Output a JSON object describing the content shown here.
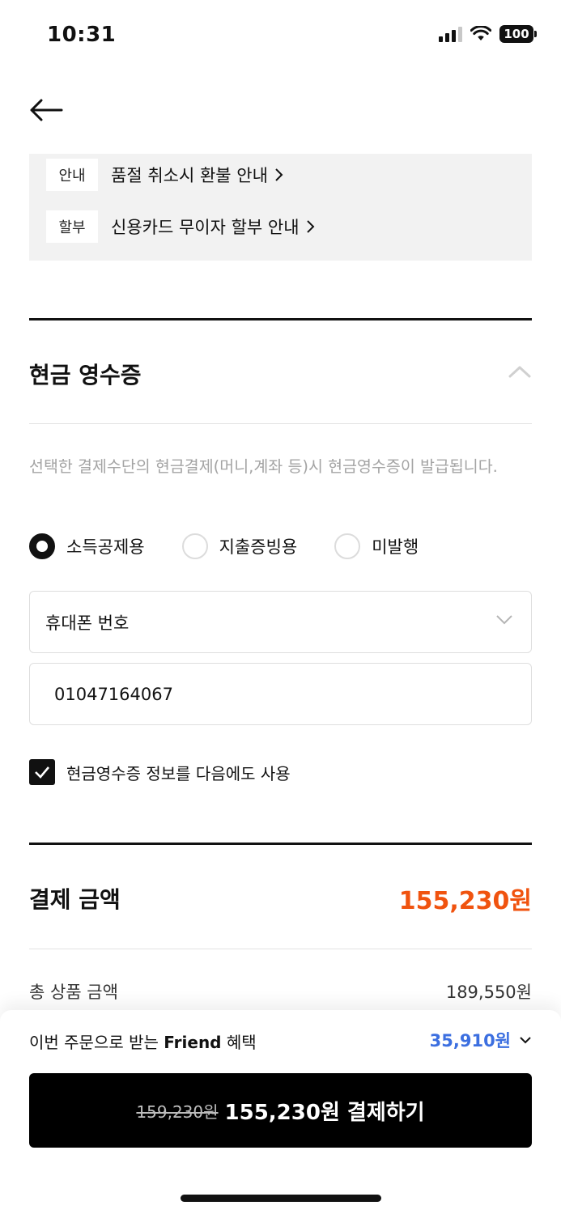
{
  "status_bar": {
    "time": "10:31",
    "battery": "100"
  },
  "notices": [
    {
      "tag": "안내",
      "text": "품절 취소시 환불 안내"
    },
    {
      "tag": "할부",
      "text": "신용카드 무이자 할부 안내"
    }
  ],
  "cash_receipt": {
    "title": "현금 영수증",
    "description": "선택한 결제수단의 현금결제(머니,계좌 등)시 현금영수증이 발급됩니다.",
    "options": [
      "소득공제용",
      "지출증빙용",
      "미발행"
    ],
    "selected_option": "소득공제용",
    "id_type": "휴대폰 번호",
    "phone_value": "01047164067",
    "save_checkbox_label": "현금영수증 정보를 다음에도 사용",
    "save_checked": true
  },
  "payment": {
    "title": "결제 금액",
    "amount": "155,230원",
    "rows": [
      {
        "label": "총 상품 금액",
        "value": "189,550원"
      }
    ]
  },
  "bottom": {
    "benefit_prefix": "이번 주문으로 받는",
    "benefit_brand": "Friend",
    "benefit_suffix": "혜택",
    "benefit_amount": "35,910원",
    "old_price": "159,230원",
    "button_label": "155,230원 결제하기"
  },
  "colors": {
    "accent_orange": "#f0530f",
    "benefit_blue": "#3c6fe0",
    "button_bg": "#000000"
  },
  "icons": {
    "back": "arrow-left-icon",
    "collapse": "chevron-up-icon",
    "select": "chevron-down-icon",
    "check": "checkmark-icon"
  }
}
